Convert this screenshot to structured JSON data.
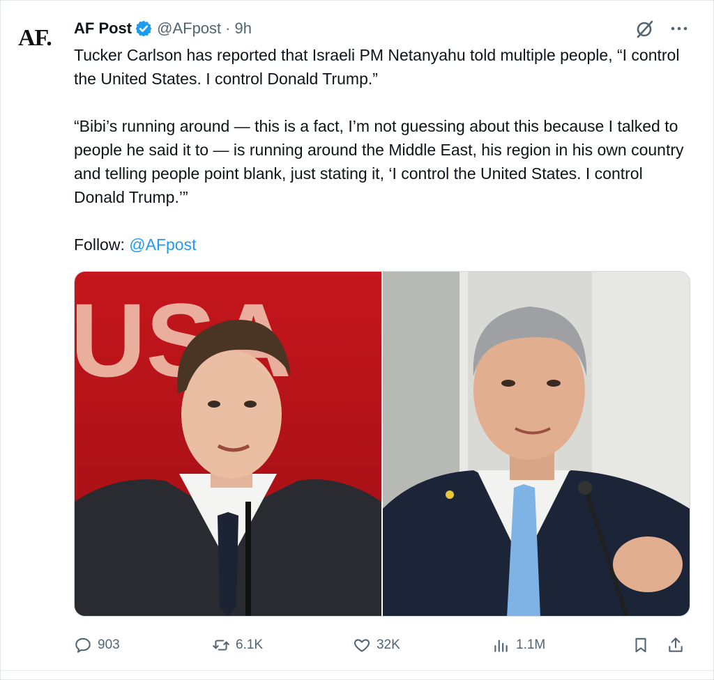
{
  "account": {
    "avatar_text": "AF.",
    "display_name": "AF Post",
    "handle": "@AFpost",
    "separator": "·",
    "time": "9h"
  },
  "tweet": {
    "paragraph_1": "Tucker Carlson has reported that Israeli PM Netanyahu told multiple people, “I control the United States. I control Donald Trump.”",
    "paragraph_2": "“Bibi’s running around — this is a fact, I’m not guessing about this because I talked to people he said it to — is running around the Middle East, his region in his own country and telling people point blank, just stating it, ‘I control the United States. I control Donald Trump.’”",
    "follow_label": "Follow:",
    "follow_mention": "@AFpost"
  },
  "media": {
    "left_sign_text": "USA"
  },
  "actions": {
    "replies": "903",
    "reposts": "6.1K",
    "likes": "32K",
    "views": "1.1M"
  },
  "icons": {
    "verified": "verified-badge-icon",
    "grok": "grok-icon",
    "more": "more-options-icon",
    "reply": "reply-icon",
    "repost": "repost-icon",
    "like": "heart-icon",
    "views": "views-icon",
    "bookmark": "bookmark-icon",
    "share": "share-icon"
  },
  "colors": {
    "accent": "#1d9bf0",
    "text_secondary": "#536471",
    "text_primary": "#0f1419"
  }
}
